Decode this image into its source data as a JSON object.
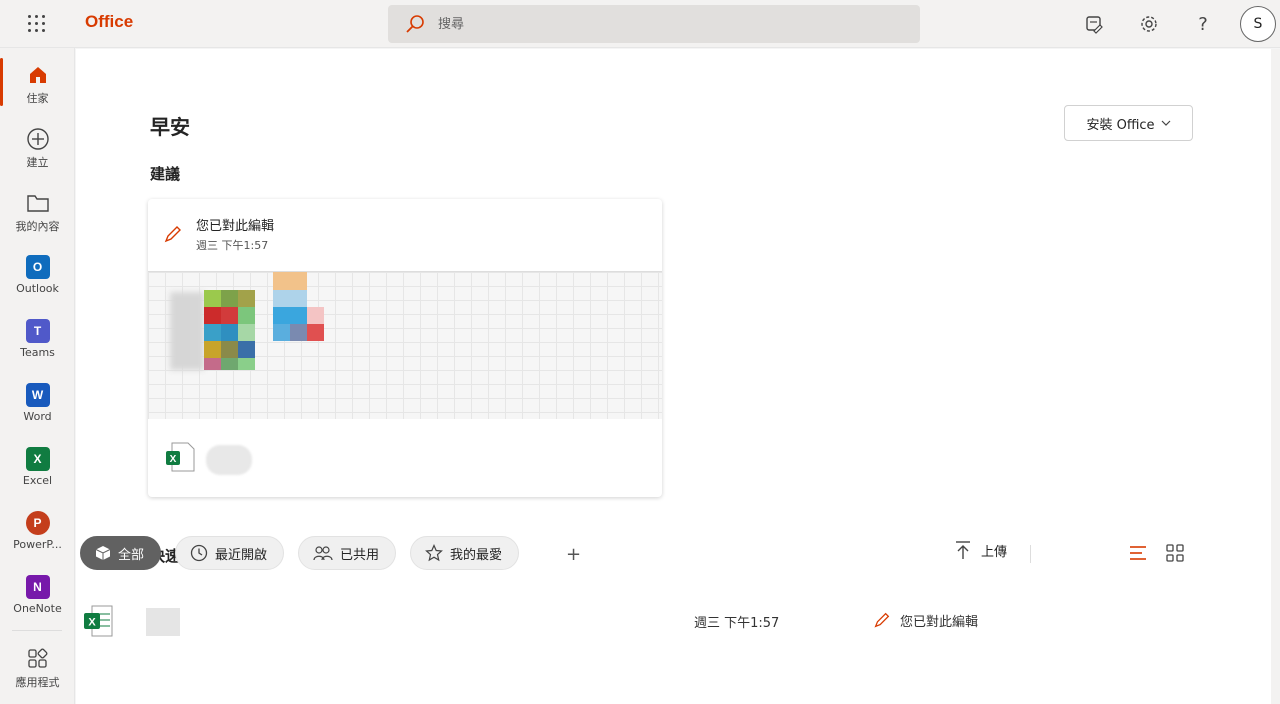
{
  "topbar": {
    "brand": "Office",
    "search_placeholder": "搜尋",
    "avatar_initial": "S"
  },
  "rail": {
    "items": [
      {
        "label": "住家"
      },
      {
        "label": "建立"
      },
      {
        "label": "我的內容"
      },
      {
        "label": "Outlook"
      },
      {
        "label": "Teams"
      },
      {
        "label": "Word"
      },
      {
        "label": "Excel"
      },
      {
        "label": "PowerP..."
      },
      {
        "label": "OneNote"
      },
      {
        "label": "應用程式"
      }
    ]
  },
  "main": {
    "greeting": "早安",
    "install_label": "安裝 Office",
    "recommended_title": "建議",
    "rec_card": {
      "activity": "您已對此編輯",
      "time": "週三 下午1:57"
    },
    "quick_access_title": "快速存取",
    "filters": [
      {
        "label": "全部"
      },
      {
        "label": "最近開啟"
      },
      {
        "label": "已共用"
      },
      {
        "label": "我的最愛"
      }
    ],
    "add_label": "+",
    "upload_label": "上傳",
    "files": [
      {
        "time": "週三 下午1:57",
        "activity": "您已對此編輯"
      }
    ]
  },
  "colors": {
    "accent": "#d83b01",
    "outlook": "#0f6cbd",
    "teams": "#5059c9",
    "word": "#185abd",
    "excel": "#107c41",
    "powerpoint": "#c43e1c",
    "onenote": "#7719aa"
  }
}
